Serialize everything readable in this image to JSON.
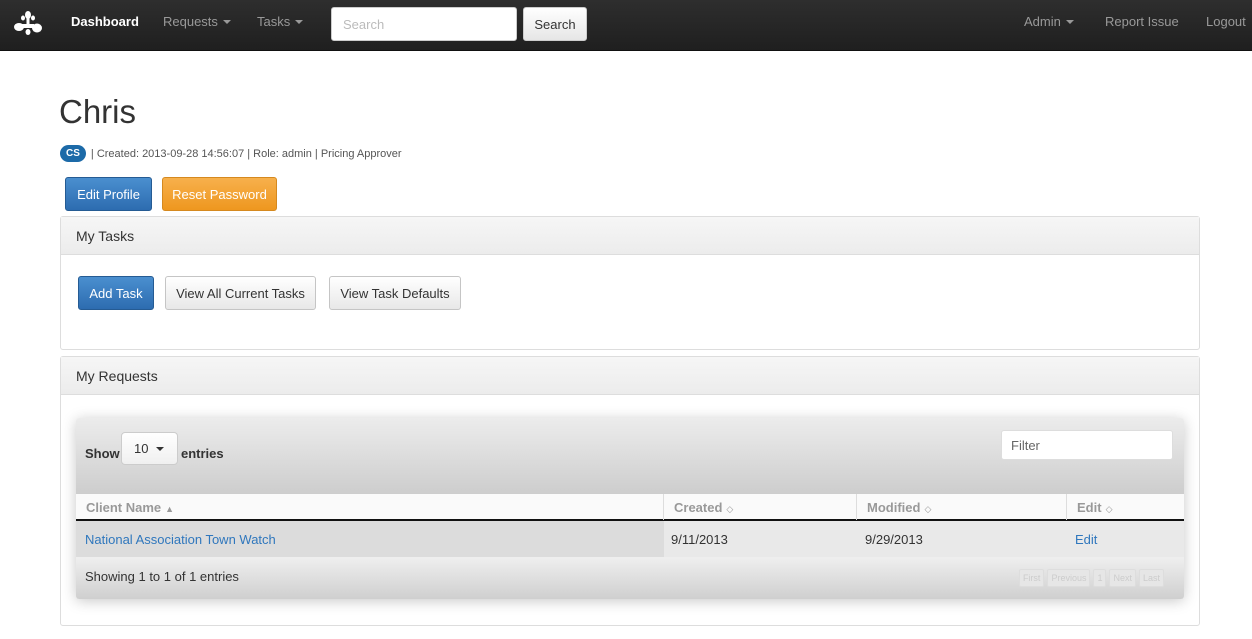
{
  "navbar": {
    "logo_icon": "flower-logo-icon",
    "items": [
      {
        "label": "Dashboard",
        "active": true,
        "dropdown": false
      },
      {
        "label": "Requests",
        "active": false,
        "dropdown": true
      },
      {
        "label": "Tasks",
        "active": false,
        "dropdown": true
      }
    ],
    "search": {
      "placeholder": "Search",
      "value": "",
      "button_label": "Search"
    },
    "right_items": [
      {
        "label": "Admin",
        "dropdown": true
      },
      {
        "label": "Report Issue",
        "dropdown": false
      },
      {
        "label": "Logout",
        "dropdown": false
      }
    ]
  },
  "profile": {
    "name": "Chris",
    "initials": "CS",
    "meta": "| Created: 2013-09-28 14:56:07 | Role: admin | Pricing Approver",
    "edit_label": "Edit Profile",
    "reset_label": "Reset Password"
  },
  "tasks_panel": {
    "title": "My Tasks",
    "buttons": [
      "Add Task",
      "View All Current Tasks",
      "View Task Defaults"
    ]
  },
  "requests_panel": {
    "title": "My Requests",
    "length": {
      "show_label": "Show",
      "value": "10",
      "entries_label": "entries"
    },
    "filter_placeholder": "Filter",
    "columns": [
      {
        "label": "Client Name",
        "sort": "asc",
        "sort_icon": "▲"
      },
      {
        "label": "Created",
        "sort": "none",
        "sort_icon": "◇"
      },
      {
        "label": "Modified",
        "sort": "none",
        "sort_icon": "◇"
      },
      {
        "label": "Edit",
        "sort": "none",
        "sort_icon": "◇"
      }
    ],
    "rows": [
      {
        "client_name": "National Association Town Watch",
        "created": "9/11/2013",
        "modified": "9/29/2013",
        "edit": "Edit"
      }
    ],
    "info": "Showing 1 to 1 of 1 entries",
    "pagination": [
      "First",
      "Previous",
      "1",
      "Next",
      "Last"
    ]
  },
  "colors": {
    "primary": "#2d6cb0",
    "warning": "#ee971f",
    "link": "#2f77bd",
    "navbar": "#262626"
  }
}
